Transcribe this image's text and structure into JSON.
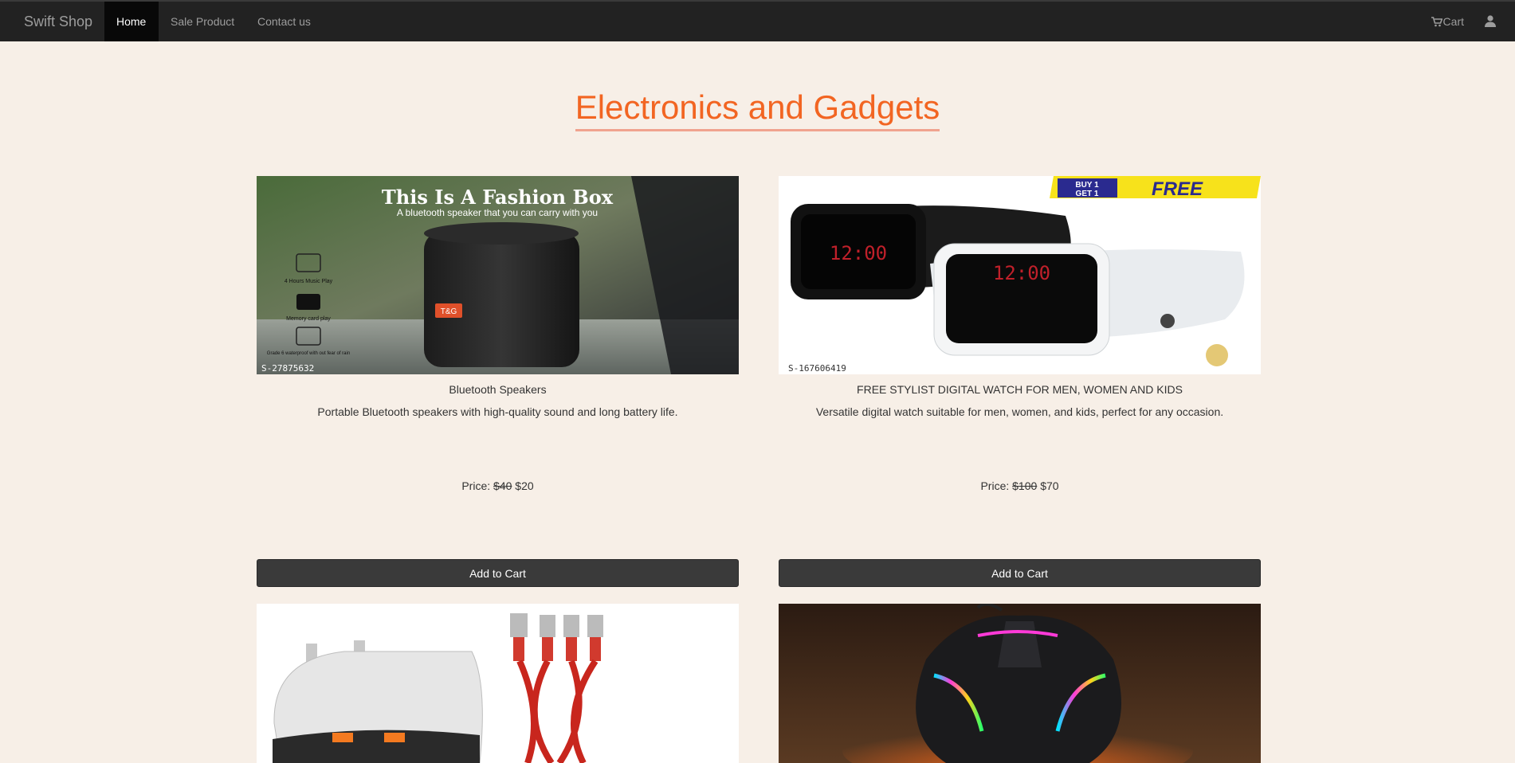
{
  "nav": {
    "brand": "Swift Shop",
    "home": "Home",
    "sale": "Sale Product",
    "contact": "Contact us",
    "cart": "Cart",
    "cart_icon": "shopping-cart-icon",
    "user_icon": "user-icon"
  },
  "page_title": "Electronics and Gadgets",
  "products": [
    {
      "name": "Bluetooth Speakers",
      "description": "Portable Bluetooth speakers with high-quality sound and long battery life.",
      "price_label": "Price:",
      "old_price": "$40",
      "new_price": "$20",
      "button": "Add to Cart",
      "image_heading": "This Is A Fashion Box",
      "image_subheading": "A bluetooth speaker that you can carry with you",
      "image_features": [
        "4 Hours Music Play",
        "Memory card play",
        "Grade 6 waterproof with out fear of rain"
      ],
      "image_brand": "T&G",
      "image_code": "S-27875632"
    },
    {
      "name": "FREE STYLIST DIGITAL WATCH FOR MEN, WOMEN AND KIDS",
      "description": "Versatile digital watch suitable for men, women, and kids, perfect for any occasion.",
      "price_label": "Price:",
      "old_price": "$100",
      "new_price": "$70",
      "button": "Add to Cart",
      "image_badge_1": "BUY 1",
      "image_badge_2": "GET 1",
      "image_badge_3": "FREE",
      "image_time": "12:00",
      "image_code": "S-167606419"
    },
    {
      "name": "",
      "description": ""
    },
    {
      "name": "",
      "description": ""
    }
  ]
}
